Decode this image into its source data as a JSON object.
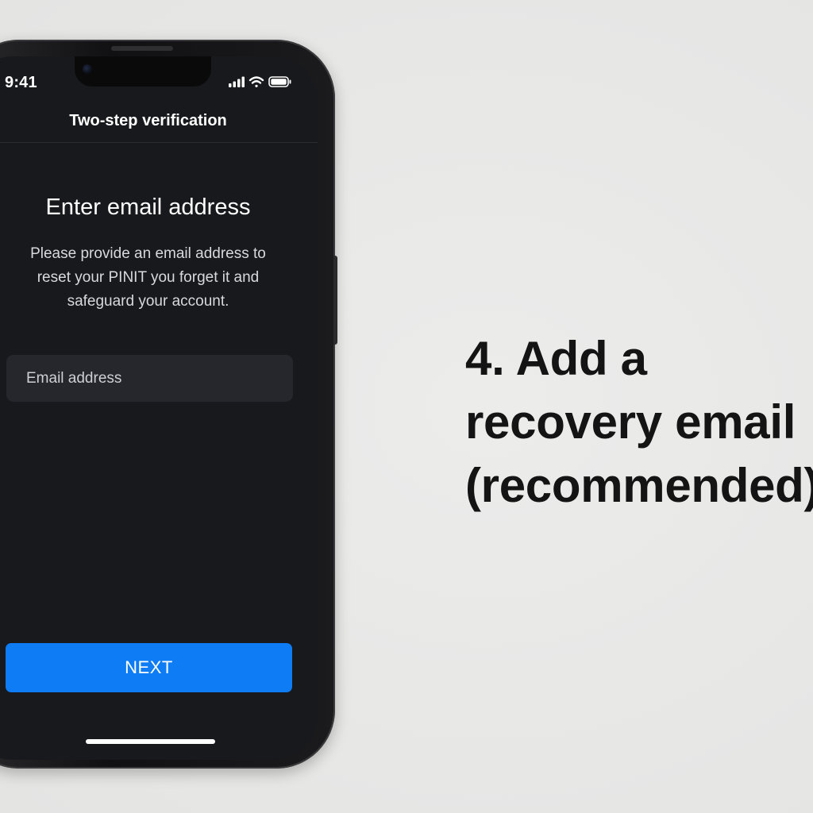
{
  "status_bar": {
    "time": "9:41",
    "icons": [
      "cellular-signal-icon",
      "wifi-icon",
      "battery-icon"
    ]
  },
  "nav": {
    "title": "Two-step verification"
  },
  "content": {
    "heading": "Enter email address",
    "description": "Please provide an email address to reset your PINIT you forget it and safeguard your account.",
    "email_field": {
      "value": "",
      "placeholder": "Email address"
    },
    "next_label": "NEXT"
  },
  "caption": {
    "line1": "4. Add a",
    "line2": "recovery email",
    "line3": "(recommended)"
  },
  "colors": {
    "screen_background": "#18191d",
    "input_background": "#26272c",
    "accent": "#0e7cf4",
    "page_background": "#e7e7e6",
    "caption_text": "#141414"
  }
}
